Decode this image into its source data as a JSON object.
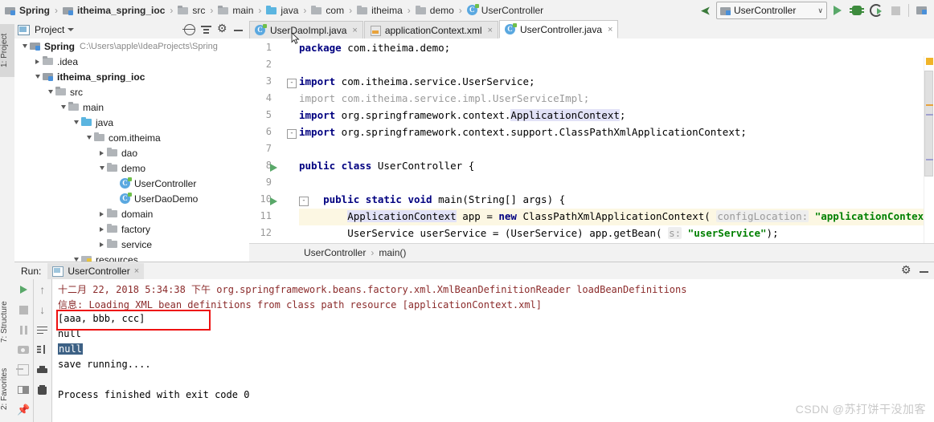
{
  "breadcrumbs": [
    {
      "label": "Spring",
      "icon": "module-icon",
      "bold": true
    },
    {
      "label": "itheima_spring_ioc",
      "icon": "module-icon",
      "bold": true
    },
    {
      "label": "src",
      "icon": "folder-icon",
      "bold": false
    },
    {
      "label": "main",
      "icon": "folder-icon",
      "bold": false
    },
    {
      "label": "java",
      "icon": "folder-blue-icon",
      "bold": false
    },
    {
      "label": "com",
      "icon": "package-icon",
      "bold": false
    },
    {
      "label": "itheima",
      "icon": "package-icon",
      "bold": false
    },
    {
      "label": "demo",
      "icon": "package-icon",
      "bold": false
    },
    {
      "label": "UserController",
      "icon": "java-class-icon",
      "bold": false
    }
  ],
  "separator": "›",
  "toolbar": {
    "run_config": "UserController",
    "chevron": "∨",
    "run_tooltip": "Run",
    "debug_tooltip": "Debug",
    "coverage_tooltip": "Run with Coverage",
    "stop_tooltip": "Stop",
    "sdk_tooltip": "Project Structure"
  },
  "left_strip": {
    "project_tab": "1: Project",
    "structure_tab": "7: Structure",
    "favorites_tab": "2: Favorites"
  },
  "project_panel": {
    "title": "Project",
    "caret": "▾",
    "tree": [
      {
        "indent": 0,
        "twisty": "down",
        "icon": "module-icon",
        "label": "Spring",
        "path": "C:\\Users\\apple\\IdeaProjects\\Spring",
        "bold": true
      },
      {
        "indent": 1,
        "twisty": "right",
        "icon": "folder-icon",
        "label": ".idea",
        "path": "",
        "bold": false
      },
      {
        "indent": 1,
        "twisty": "down",
        "icon": "module-icon",
        "label": "itheima_spring_ioc",
        "path": "",
        "bold": true
      },
      {
        "indent": 2,
        "twisty": "down",
        "icon": "folder-icon",
        "label": "src",
        "path": "",
        "bold": false
      },
      {
        "indent": 3,
        "twisty": "down",
        "icon": "folder-icon",
        "label": "main",
        "path": "",
        "bold": false
      },
      {
        "indent": 4,
        "twisty": "down",
        "icon": "folder-blue-icon",
        "label": "java",
        "path": "",
        "bold": false
      },
      {
        "indent": 5,
        "twisty": "down",
        "icon": "package-icon",
        "label": "com.itheima",
        "path": "",
        "bold": false
      },
      {
        "indent": 6,
        "twisty": "right",
        "icon": "package-icon",
        "label": "dao",
        "path": "",
        "bold": false
      },
      {
        "indent": 6,
        "twisty": "down",
        "icon": "package-icon",
        "label": "demo",
        "path": "",
        "bold": false
      },
      {
        "indent": 7,
        "twisty": "none",
        "icon": "java-class-icon",
        "label": "UserController",
        "path": "",
        "bold": false
      },
      {
        "indent": 7,
        "twisty": "none",
        "icon": "java-class-icon",
        "label": "UserDaoDemo",
        "path": "",
        "bold": false
      },
      {
        "indent": 6,
        "twisty": "right",
        "icon": "package-icon",
        "label": "domain",
        "path": "",
        "bold": false
      },
      {
        "indent": 6,
        "twisty": "right",
        "icon": "package-icon",
        "label": "factory",
        "path": "",
        "bold": false
      },
      {
        "indent": 6,
        "twisty": "right",
        "icon": "package-icon",
        "label": "service",
        "path": "",
        "bold": false
      },
      {
        "indent": 4,
        "twisty": "down",
        "icon": "resources-icon",
        "label": "resources",
        "path": "",
        "bold": false
      }
    ]
  },
  "editor": {
    "tabs": [
      {
        "label": "UserDaoImpl.java",
        "icon": "java-class-icon",
        "active": false,
        "close": "×"
      },
      {
        "label": "applicationContext.xml",
        "icon": "xml-file-icon",
        "active": false,
        "close": "×"
      },
      {
        "label": "UserController.java",
        "icon": "java-class-icon",
        "active": true,
        "close": "×"
      }
    ],
    "line_numbers": [
      "1",
      "2",
      "3",
      "4",
      "5",
      "6",
      "7",
      "8",
      "9",
      "10",
      "11",
      "12"
    ],
    "code_lines": [
      {
        "n": 1,
        "html": "<span class=\"kw\">package</span> com.itheima.demo;"
      },
      {
        "n": 2,
        "html": ""
      },
      {
        "n": 3,
        "html": "<span class=\"kw\">import</span> com.itheima.service.UserService;"
      },
      {
        "n": 4,
        "html": "<span class=\"dim\">import com.itheima.service.impl.UserServiceImpl;</span>"
      },
      {
        "n": 5,
        "html": "<span class=\"kw\">import</span> org.springframework.context.<span class=\"ident-hl\">ApplicationContext</span>;"
      },
      {
        "n": 6,
        "html": "<span class=\"kw\">import</span> org.springframework.context.support.ClassPathXmlApplicationContext;"
      },
      {
        "n": 7,
        "html": ""
      },
      {
        "n": 8,
        "html": "<span class=\"kw\">public class</span> UserController {"
      },
      {
        "n": 9,
        "html": ""
      },
      {
        "n": 10,
        "html": "    <span class=\"kw\">public static void</span> main(String[] args) {"
      },
      {
        "n": 11,
        "html": "        <span class=\"ident-hl\">ApplicationContext</span> app = <span class=\"kw\">new</span> ClassPathXmlApplicationContext( <span class=\"hint\">configLocation:</span> <span class=\"str\">\"applicationContext.xml\"</span>)"
      },
      {
        "n": 12,
        "html": "        UserService userService = (UserService) app.getBean( <span class=\"hint\">s:</span> <span class=\"str\">\"userService\"</span>);"
      }
    ],
    "breadcrumb": {
      "class": "UserController",
      "method": "main()",
      "sep": "›"
    }
  },
  "run_panel": {
    "run_label": "Run:",
    "tab_label": "UserController",
    "tab_close": "×",
    "tools_left": [
      "rerun-icon",
      "stop-icon",
      "pause-icon",
      "screenshot-icon",
      "export-icon",
      "layout-icon",
      "pin-icon"
    ],
    "tools_right": [
      "scroll-up-icon",
      "scroll-down-icon",
      "soft-wrap-icon",
      "sort-icon",
      "print-icon",
      "clear-all-icon"
    ],
    "console_lines": [
      {
        "text": "十二月 22, 2018 5:34:38 下午 org.springframework.beans.factory.xml.XmlBeanDefinitionReader loadBeanDefinitions",
        "color": "red"
      },
      {
        "text": "信息: Loading XML bean definitions from class path resource [applicationContext.xml]",
        "color": "red"
      },
      {
        "text": "[aaa, bbb, ccc]",
        "color": "black",
        "boxed": true
      },
      {
        "text": "null",
        "color": "black"
      },
      {
        "text": "null",
        "color": "black",
        "selected": true
      },
      {
        "text": "save running....",
        "color": "black"
      },
      {
        "text": "",
        "color": "black"
      },
      {
        "text": "Process finished with exit code 0",
        "color": "black"
      }
    ],
    "highlight_box_color": "#ee1111"
  },
  "watermark": "CSDN @苏打饼干没加客"
}
